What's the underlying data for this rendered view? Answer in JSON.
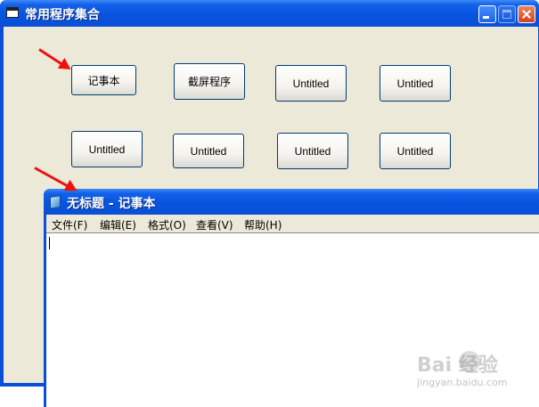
{
  "main_window": {
    "title": "常用程序集合",
    "buttons": [
      {
        "label": "记事本"
      },
      {
        "label": "截屏程序"
      },
      {
        "label": "Untitled"
      },
      {
        "label": "Untitled"
      },
      {
        "label": "Untitled"
      },
      {
        "label": "Untitled"
      },
      {
        "label": "Untitled"
      },
      {
        "label": "Untitled"
      }
    ]
  },
  "notepad": {
    "title": "无标题 - 记事本",
    "menu": [
      {
        "label": "文件(F)"
      },
      {
        "label": "编辑(E)"
      },
      {
        "label": "格式(O)"
      },
      {
        "label": "查看(V)"
      },
      {
        "label": "帮助(H)"
      }
    ]
  },
  "watermark": {
    "brand": "Bai 经验",
    "url": "jingyan.baidu.com"
  },
  "colors": {
    "titlebar": "#0a4fd6",
    "client_bg": "#ece9d8",
    "arrow": "#ee1111"
  }
}
